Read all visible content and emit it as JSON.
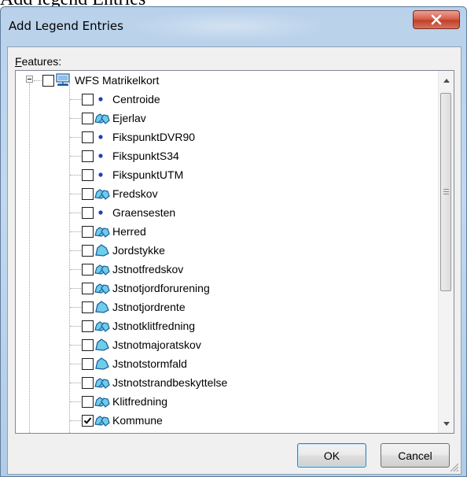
{
  "page_heading": "Add legend Entries",
  "dialog": {
    "title": "Add Legend Entries",
    "close_glyph": "x"
  },
  "features": {
    "label_mnemonic": "F",
    "label_rest": "eatures:"
  },
  "tree": {
    "root": {
      "label": "WFS Matrikelkort",
      "icon": "map-service-icon",
      "checked": false,
      "expanded": true
    },
    "items": [
      {
        "label": "Centroide",
        "icon": "point-layer-icon",
        "checked": false
      },
      {
        "label": "Ejerlav",
        "icon": "multipolygon-layer-icon",
        "checked": false
      },
      {
        "label": "FikspunktDVR90",
        "icon": "point-layer-icon",
        "checked": false
      },
      {
        "label": "FikspunktS34",
        "icon": "point-layer-icon",
        "checked": false
      },
      {
        "label": "FikspunktUTM",
        "icon": "point-layer-icon",
        "checked": false
      },
      {
        "label": "Fredskov",
        "icon": "multipolygon-layer-icon",
        "checked": false
      },
      {
        "label": "Graensesten",
        "icon": "point-layer-icon",
        "checked": false
      },
      {
        "label": "Herred",
        "icon": "multipolygon-layer-icon",
        "checked": false
      },
      {
        "label": "Jordstykke",
        "icon": "polygon-layer-icon",
        "checked": false
      },
      {
        "label": "Jstnotfredskov",
        "icon": "multipolygon-layer-icon",
        "checked": false
      },
      {
        "label": "Jstnotjordforurening",
        "icon": "multipolygon-layer-icon",
        "checked": false
      },
      {
        "label": "Jstnotjordrente",
        "icon": "polygon-layer-icon",
        "checked": false
      },
      {
        "label": "Jstnotklitfredning",
        "icon": "multipolygon-layer-icon",
        "checked": false
      },
      {
        "label": "Jstnotmajoratskov",
        "icon": "polygon-layer-icon",
        "checked": false
      },
      {
        "label": "Jstnotstormfald",
        "icon": "polygon-layer-icon",
        "checked": false
      },
      {
        "label": "Jstnotstrandbeskyttelse",
        "icon": "multipolygon-layer-icon",
        "checked": false
      },
      {
        "label": "Klitfredning",
        "icon": "multipolygon-layer-icon",
        "checked": false
      },
      {
        "label": "Kommune",
        "icon": "multipolygon-layer-icon",
        "checked": true
      }
    ]
  },
  "scrollbar": {
    "up_icon": "scroll-up-arrow-icon",
    "down_icon": "scroll-down-arrow-icon"
  },
  "buttons": {
    "ok": "OK",
    "cancel": "Cancel"
  },
  "colors": {
    "title_bar": "#b9d1ea",
    "close_button": "#c2402a",
    "point_marker": "#1f3fbf",
    "polygon_fill": "#6ecde8",
    "polygon_outline": "#1d5fa0"
  }
}
